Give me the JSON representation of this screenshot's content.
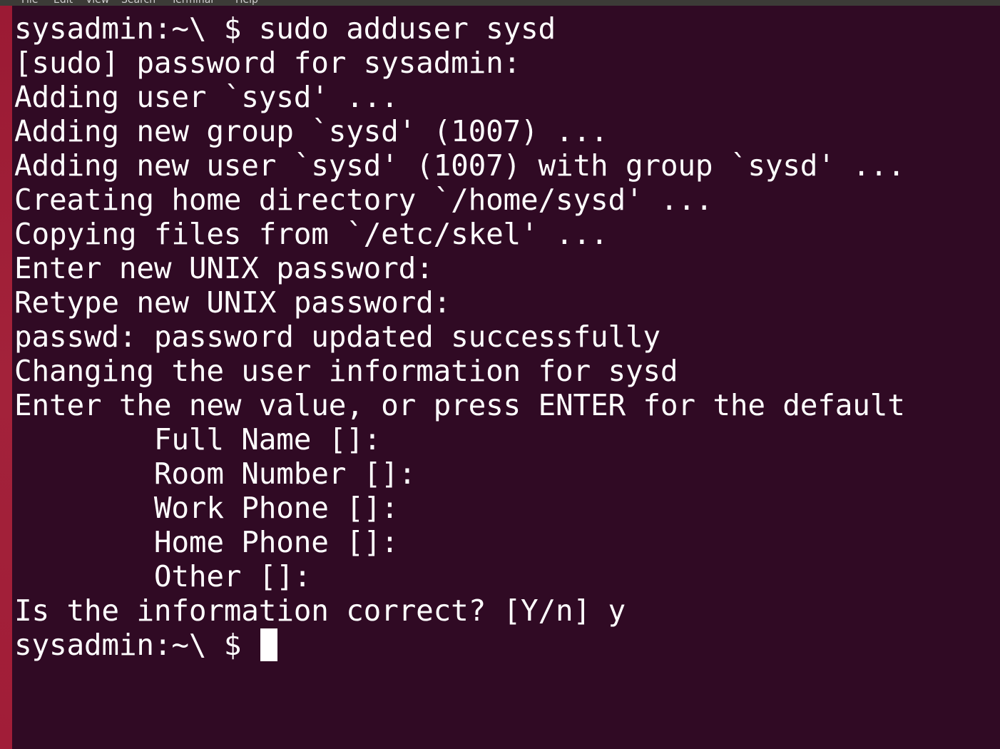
{
  "menubar": {
    "items": [
      "File",
      "Edit",
      "View",
      "Search",
      "Terminal",
      "Help"
    ]
  },
  "terminal": {
    "lines": [
      "sysadmin:~\\ $ sudo adduser sysd",
      "[sudo] password for sysadmin:",
      "Adding user `sysd' ...",
      "Adding new group `sysd' (1007) ...",
      "Adding new user `sysd' (1007) with group `sysd' ...",
      "Creating home directory `/home/sysd' ...",
      "Copying files from `/etc/skel' ...",
      "Enter new UNIX password:",
      "Retype new UNIX password:",
      "passwd: password updated successfully",
      "Changing the user information for sysd",
      "Enter the new value, or press ENTER for the default",
      "\tFull Name []:",
      "\tRoom Number []:",
      "\tWork Phone []:",
      "\tHome Phone []:",
      "\tOther []:",
      "Is the information correct? [Y/n] y"
    ],
    "prompt": "sysadmin:~\\ $ "
  },
  "colors": {
    "background": "#300a24",
    "foreground": "#ffffff",
    "edge": "#a11d38"
  }
}
